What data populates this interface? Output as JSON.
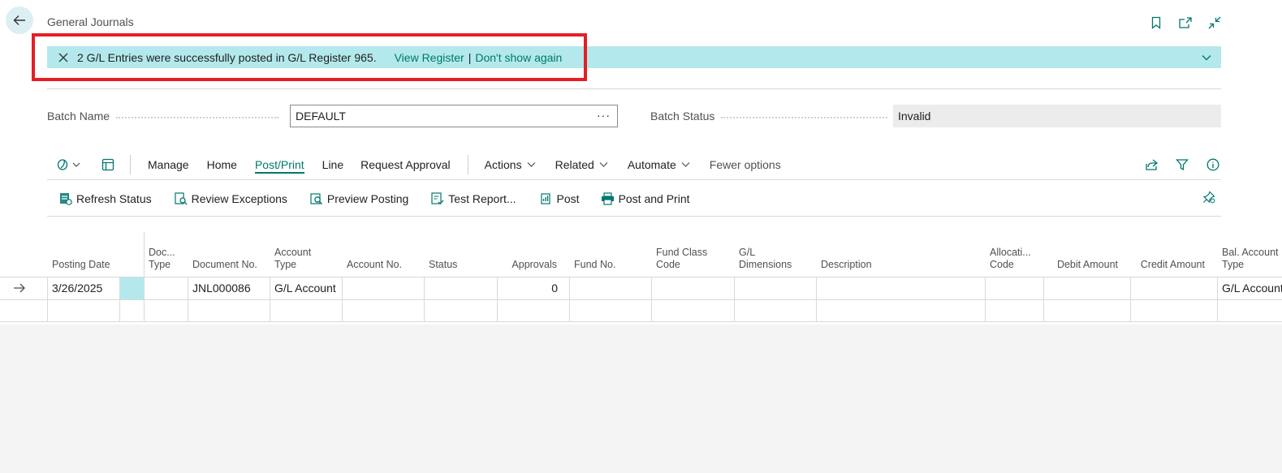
{
  "page": {
    "title": "General Journals"
  },
  "notification": {
    "message": "2 G/L Entries were successfully posted in G/L Register 965.",
    "view_register": "View Register",
    "separator": "|",
    "dont_show": "Don't show again"
  },
  "fields": {
    "batch_name_label": "Batch Name",
    "batch_name_value": "DEFAULT",
    "batch_name_more": "···",
    "batch_status_label": "Batch Status",
    "batch_status_value": "Invalid"
  },
  "actionbar": {
    "manage": "Manage",
    "home": "Home",
    "post_print": "Post/Print",
    "line": "Line",
    "request_approval": "Request Approval",
    "actions": "Actions",
    "related": "Related",
    "automate": "Automate",
    "fewer_options": "Fewer options"
  },
  "subactions": {
    "refresh_status": "Refresh Status",
    "review_exceptions": "Review Exceptions",
    "preview_posting": "Preview Posting",
    "test_report": "Test Report...",
    "post": "Post",
    "post_and_print": "Post and Print"
  },
  "table": {
    "headers": {
      "posting_date": "Posting Date",
      "doc_type": "Doc...\nType",
      "document_no": "Document No.",
      "account_type": "Account\nType",
      "account_no": "Account No.",
      "status": "Status",
      "approvals": "Approvals",
      "fund_no": "Fund No.",
      "fund_class_code": "Fund Class\nCode",
      "gl_dimensions": "G/L\nDimensions",
      "description": "Description",
      "allocation_code": "Allocati...\nCode",
      "debit_amount": "Debit Amount",
      "credit_amount": "Credit Amount",
      "bal_account_type": "Bal. Account\nType"
    },
    "rows": [
      {
        "posting_date": "3/26/2025",
        "document_no": "JNL000086",
        "account_type": "G/L Account",
        "approvals": "0",
        "bal_account_type": "G/L Account"
      }
    ]
  },
  "colors": {
    "accent": "#00776f",
    "notification_bg": "#b3e9ec",
    "highlight_border": "#e41f24"
  }
}
